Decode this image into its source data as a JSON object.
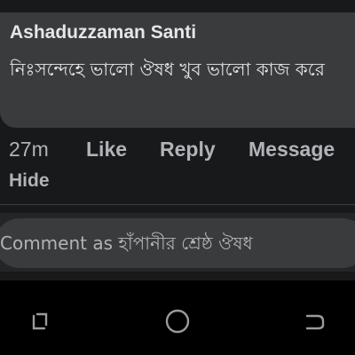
{
  "comment": {
    "author": "Ashaduzzaman Santi",
    "text": "নিঃসন্দেহে ভালো ঔষধ খুব ভালো কাজ করে",
    "timestamp": "27m",
    "actions": {
      "like": "Like",
      "reply": "Reply",
      "message": "Message",
      "hide": "Hide"
    }
  },
  "composer": {
    "placeholder": "Comment as হাঁপানীর শ্রেষ্ঠ ঔষধ"
  },
  "system_nav": {
    "recent_icon": "recent-apps-icon",
    "home_icon": "home-icon",
    "back_icon": "back-icon"
  },
  "colors": {
    "background": "#18191a",
    "bubble": "#3a3b3c",
    "text_primary": "#e4e6eb",
    "text_secondary": "#b0b3b8",
    "nav_bar": "#000000"
  }
}
